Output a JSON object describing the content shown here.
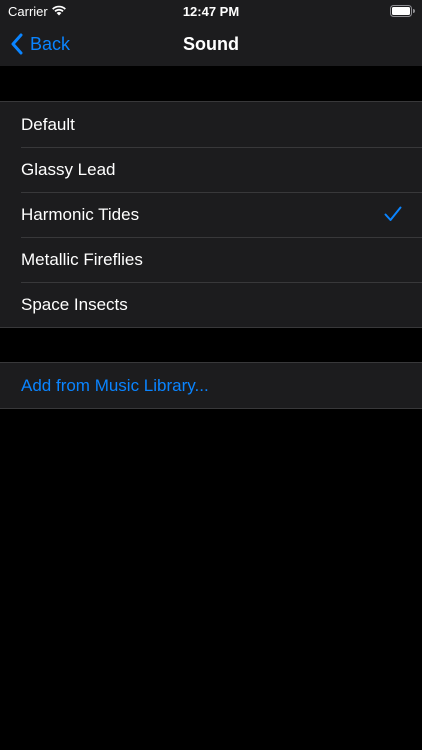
{
  "status_bar": {
    "carrier": "Carrier",
    "time": "12:47 PM",
    "wifi_icon": "wifi-icon",
    "battery_icon": "battery-icon"
  },
  "nav": {
    "back_label": "Back",
    "title": "Sound"
  },
  "sounds": {
    "items": [
      {
        "label": "Default",
        "selected": false
      },
      {
        "label": "Glassy Lead",
        "selected": false
      },
      {
        "label": "Harmonic Tides",
        "selected": true
      },
      {
        "label": "Metallic Fireflies",
        "selected": false
      },
      {
        "label": "Space Insects",
        "selected": false
      }
    ]
  },
  "library": {
    "add_label": "Add from Music Library..."
  },
  "colors": {
    "accent": "#0a84ff",
    "background": "#000000",
    "cell": "#1c1c1e",
    "separator": "#38383a"
  }
}
